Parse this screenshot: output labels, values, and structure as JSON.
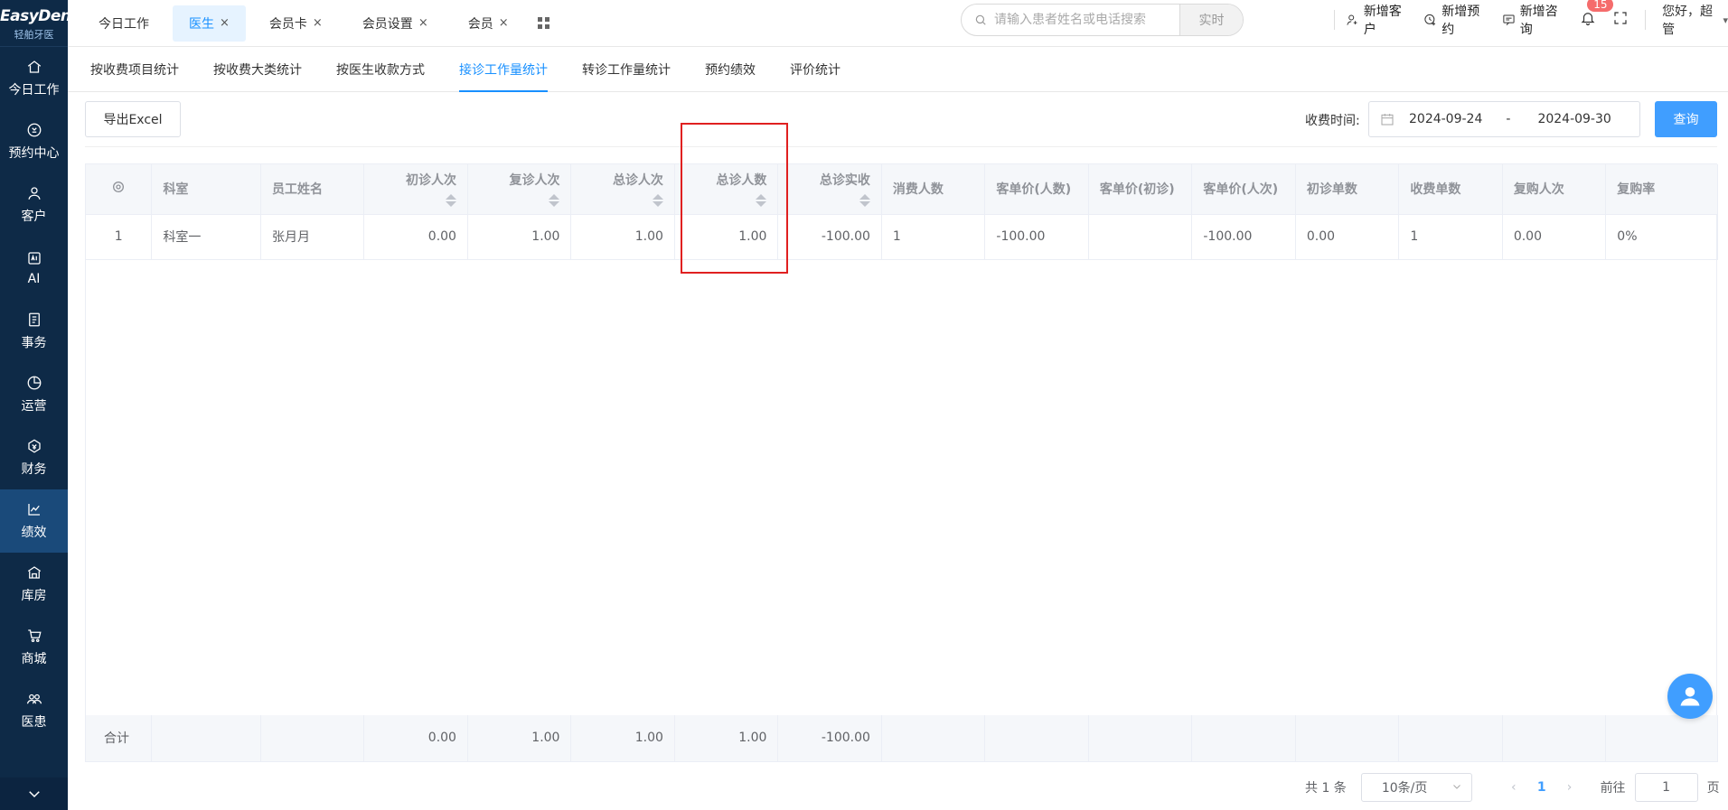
{
  "logo": {
    "en": "EasyDent",
    "cn": "轻舶牙医"
  },
  "sidebar": {
    "items": [
      {
        "label": "今日工作",
        "icon": "home-icon"
      },
      {
        "label": "预约中心",
        "icon": "appointment-icon"
      },
      {
        "label": "客户",
        "icon": "customer-icon"
      },
      {
        "label": "AI",
        "icon": "ai-icon"
      },
      {
        "label": "事务",
        "icon": "task-icon"
      },
      {
        "label": "运营",
        "icon": "pie-chart-icon"
      },
      {
        "label": "财务",
        "icon": "finance-icon"
      },
      {
        "label": "绩效",
        "icon": "trend-icon",
        "active": true
      },
      {
        "label": "库房",
        "icon": "warehouse-icon"
      },
      {
        "label": "商城",
        "icon": "cart-icon"
      },
      {
        "label": "医患",
        "icon": "doctor-patient-icon"
      }
    ]
  },
  "topbar": {
    "tabs": [
      {
        "label": "今日工作",
        "closable": false
      },
      {
        "label": "医生",
        "closable": true,
        "active": true
      },
      {
        "label": "会员卡",
        "closable": true
      },
      {
        "label": "会员设置",
        "closable": true
      },
      {
        "label": "会员",
        "closable": true
      }
    ],
    "close_glyph": "×",
    "search": {
      "placeholder": "请输入患者姓名或电话搜索",
      "mode": "实时"
    },
    "actions": [
      {
        "label": "新增客户",
        "icon": "add-customer-icon"
      },
      {
        "label": "新增预约",
        "icon": "add-appointment-icon"
      },
      {
        "label": "新增咨询",
        "icon": "add-consult-icon"
      }
    ],
    "notifications": "15",
    "greeting": "您好，超管"
  },
  "subtabs": [
    {
      "label": "按收费项目统计"
    },
    {
      "label": "按收费大类统计"
    },
    {
      "label": "按医生收款方式"
    },
    {
      "label": "接诊工作量统计",
      "active": true
    },
    {
      "label": "转诊工作量统计"
    },
    {
      "label": "预约绩效"
    },
    {
      "label": "评价统计"
    }
  ],
  "toolbar": {
    "export_label": "导出Excel",
    "date_label": "收费时间:",
    "date_start": "2024-09-24",
    "date_sep": "-",
    "date_end": "2024-09-30",
    "query_label": "查询"
  },
  "table": {
    "headers": [
      {
        "label": "",
        "icon": "settings-icon"
      },
      {
        "label": "科室"
      },
      {
        "label": "员工姓名"
      },
      {
        "label": "初诊人次",
        "sortable": true
      },
      {
        "label": "复诊人次",
        "sortable": true
      },
      {
        "label": "总诊人次",
        "sortable": true
      },
      {
        "label": "总诊人数",
        "sortable": true
      },
      {
        "label": "总诊实收",
        "sortable": true
      },
      {
        "label": "消费人数"
      },
      {
        "label": "客单价(人数)"
      },
      {
        "label": "客单价(初诊)"
      },
      {
        "label": "客单价(人次)"
      },
      {
        "label": "初诊单数"
      },
      {
        "label": "收费单数"
      },
      {
        "label": "复购人次"
      },
      {
        "label": "复购率"
      }
    ],
    "rows": [
      [
        "1",
        "科室一",
        "张月月",
        "0.00",
        "1.00",
        "1.00",
        "1.00",
        "-100.00",
        "1",
        "-100.00",
        "",
        "-100.00",
        "0.00",
        "1",
        "0.00",
        "0%"
      ]
    ],
    "footer": [
      "合计",
      "",
      "",
      "0.00",
      "1.00",
      "1.00",
      "1.00",
      "-100.00",
      "",
      "",
      "",
      "",
      "",
      "",
      "",
      ""
    ]
  },
  "pagination": {
    "total": "共 1 条",
    "page_size": "10条/页",
    "current": "1",
    "goto_label": "前往",
    "goto_value": "1",
    "page_unit": "页"
  }
}
